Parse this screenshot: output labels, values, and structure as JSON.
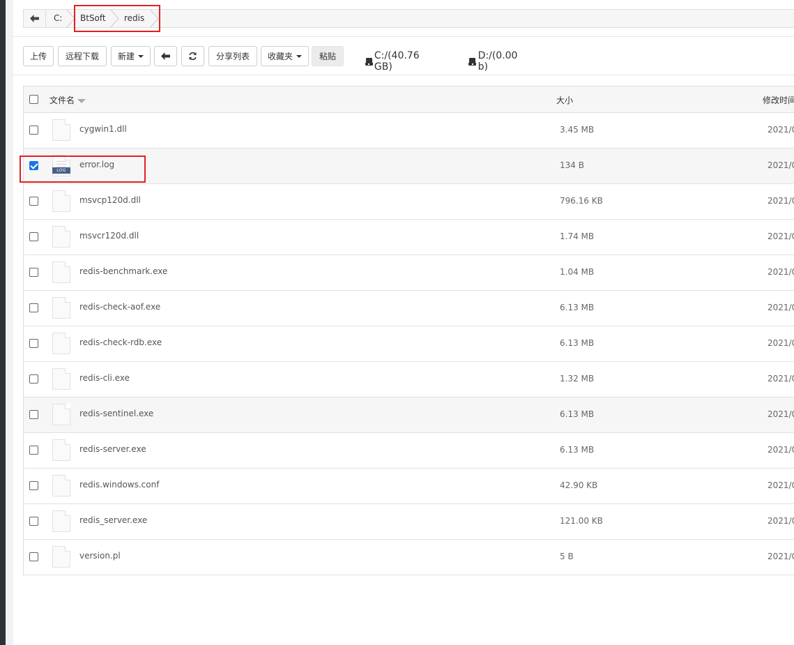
{
  "breadcrumb": {
    "segments": [
      "C:",
      "BtSoft",
      "redis"
    ]
  },
  "toolbar": {
    "upload": "上传",
    "remote_download": "远程下载",
    "new": "新建",
    "share_list": "分享列表",
    "favorites": "收藏夹",
    "paste": "粘贴"
  },
  "disks": [
    {
      "label": "C:/(40.76 GB)"
    },
    {
      "label": "D:/(0.00 b)"
    }
  ],
  "table": {
    "headers": {
      "name": "文件名",
      "size": "大小",
      "modified": "修改时间"
    },
    "rows": [
      {
        "name": "cygwin1.dll",
        "size": "3.45 MB",
        "date": "2021/0",
        "checked": false
      },
      {
        "name": "error.log",
        "size": "134 B",
        "date": "2021/0",
        "checked": true,
        "icon_tag": "LOG"
      },
      {
        "name": "msvcp120d.dll",
        "size": "796.16 KB",
        "date": "2021/0",
        "checked": false
      },
      {
        "name": "msvcr120d.dll",
        "size": "1.74 MB",
        "date": "2021/0",
        "checked": false
      },
      {
        "name": "redis-benchmark.exe",
        "size": "1.04 MB",
        "date": "2021/0",
        "checked": false
      },
      {
        "name": "redis-check-aof.exe",
        "size": "6.13 MB",
        "date": "2021/0",
        "checked": false
      },
      {
        "name": "redis-check-rdb.exe",
        "size": "6.13 MB",
        "date": "2021/0",
        "checked": false
      },
      {
        "name": "redis-cli.exe",
        "size": "1.32 MB",
        "date": "2021/0",
        "checked": false
      },
      {
        "name": "redis-sentinel.exe",
        "size": "6.13 MB",
        "date": "2021/0",
        "checked": false
      },
      {
        "name": "redis-server.exe",
        "size": "6.13 MB",
        "date": "2021/0",
        "checked": false
      },
      {
        "name": "redis.windows.conf",
        "size": "42.90 KB",
        "date": "2021/0",
        "checked": false
      },
      {
        "name": "redis_server.exe",
        "size": "121.00 KB",
        "date": "2021/0",
        "checked": false
      },
      {
        "name": "version.pl",
        "size": "5 B",
        "date": "2021/0",
        "checked": false
      }
    ]
  },
  "colors": {
    "highlight": "#e02020",
    "checkbox_checked": "#1a73e8",
    "sidebar_dark": "#2f3138"
  }
}
